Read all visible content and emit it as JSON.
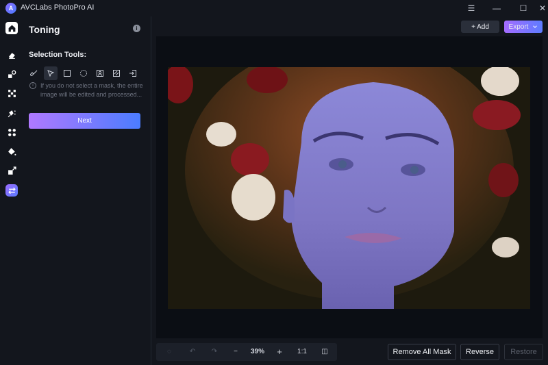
{
  "app": {
    "title": "AVCLabs PhotoPro AI",
    "logo_letter": "A"
  },
  "window_controls": {
    "menu": "☰",
    "minimize": "—",
    "maximize": "☐",
    "close": "✕"
  },
  "sidebar": {
    "items": [
      {
        "name": "home",
        "icon": "home-icon"
      },
      {
        "name": "eraser",
        "icon": "eraser-icon"
      },
      {
        "name": "replace",
        "icon": "replace-icon"
      },
      {
        "name": "upscale",
        "icon": "upscale-icon"
      },
      {
        "name": "retouch",
        "icon": "retouch-icon"
      },
      {
        "name": "enhance",
        "icon": "enhance-icon"
      },
      {
        "name": "colorize",
        "icon": "colorize-icon"
      },
      {
        "name": "expand",
        "icon": "expand-icon"
      },
      {
        "name": "toning",
        "icon": "toning-icon",
        "active": true
      }
    ]
  },
  "panel": {
    "title": "Toning",
    "info_icon": "i",
    "selection_label": "Selection Tools:",
    "tools": [
      "brush",
      "select-pointer",
      "rectangle",
      "ellipse",
      "portrait",
      "background",
      "import"
    ],
    "active_tool": "select-pointer",
    "hint": "If you do not select a mask, the entire image will be edited and processed...",
    "next_label": "Next"
  },
  "toolbar": {
    "add_label": "+ Add",
    "export_label": "Export"
  },
  "bottom": {
    "zoom_out": "−",
    "zoom_value": "39%",
    "zoom_in": "+",
    "ratio": "1:1",
    "remove_all_mask": "Remove All Mask",
    "reverse": "Reverse",
    "restore": "Restore"
  },
  "colors": {
    "accent_start": "#b079ff",
    "accent_end": "#4b7cff",
    "bg": "#13161d"
  }
}
